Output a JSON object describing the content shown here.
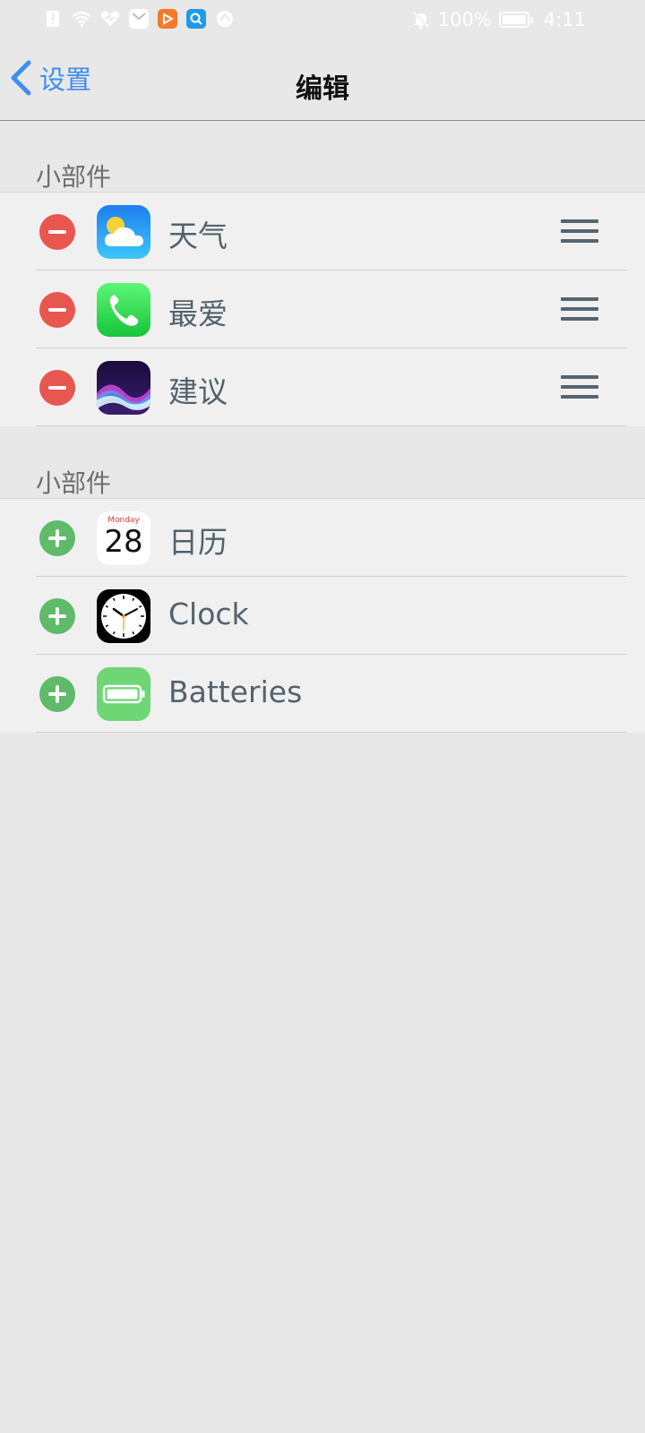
{
  "status_bar": {
    "battery_percent": "100%",
    "time": "4:11",
    "left_icons": [
      "alert-icon",
      "wifi-icon",
      "health-icon",
      "message-icon",
      "video-app-icon",
      "search-app-icon",
      "browser-icon"
    ],
    "right_icons": [
      "mute-bell-icon",
      "battery-icon"
    ]
  },
  "nav": {
    "back_label": "设置",
    "title": "编辑"
  },
  "sections": [
    {
      "header": "小部件",
      "items": [
        {
          "label": "天气",
          "icon": "weather-icon",
          "action": "remove"
        },
        {
          "label": "最爱",
          "icon": "phone-icon",
          "action": "remove"
        },
        {
          "label": "建议",
          "icon": "siri-icon",
          "action": "remove"
        }
      ]
    },
    {
      "header": "小部件",
      "items": [
        {
          "label": "日历",
          "icon": "calendar-icon",
          "action": "add",
          "calendar_day_name": "Monday",
          "calendar_day_number": "28"
        },
        {
          "label": "Clock",
          "icon": "clock-icon",
          "action": "add"
        },
        {
          "label": "Batteries",
          "icon": "batteries-icon",
          "action": "add"
        }
      ]
    }
  ],
  "colors": {
    "background": "#e8e8e8",
    "list_background": "#f0f0f0",
    "accent_blue": "#3d8ff0",
    "remove_red": "#e85650",
    "add_green": "#5fba6a",
    "label_text": "#52626d"
  }
}
